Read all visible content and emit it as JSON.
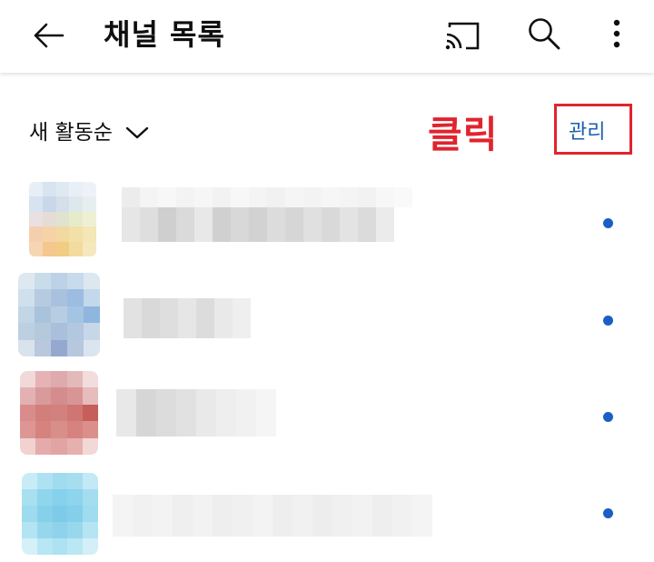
{
  "header": {
    "title": "채널 목록",
    "back_icon": "arrow-left-icon",
    "cast_icon": "cast-icon",
    "search_icon": "search-icon",
    "more_icon": "more-vert-icon"
  },
  "toolbar": {
    "sort_label": "새 활동순",
    "sort_icon": "chevron-down-icon",
    "manage_label": "관리",
    "annotation_text": "클릭"
  },
  "colors": {
    "annotation_red": "#e0242e",
    "manage_blue": "#1a5fb0",
    "unread_dot_blue": "#1c5fc3"
  },
  "channels": [
    {
      "name": "",
      "detail": "",
      "unread": true
    },
    {
      "name": "",
      "detail": "",
      "unread": true
    },
    {
      "name": "",
      "detail": "",
      "unread": true
    },
    {
      "name": "",
      "detail": "",
      "unread": true
    }
  ]
}
